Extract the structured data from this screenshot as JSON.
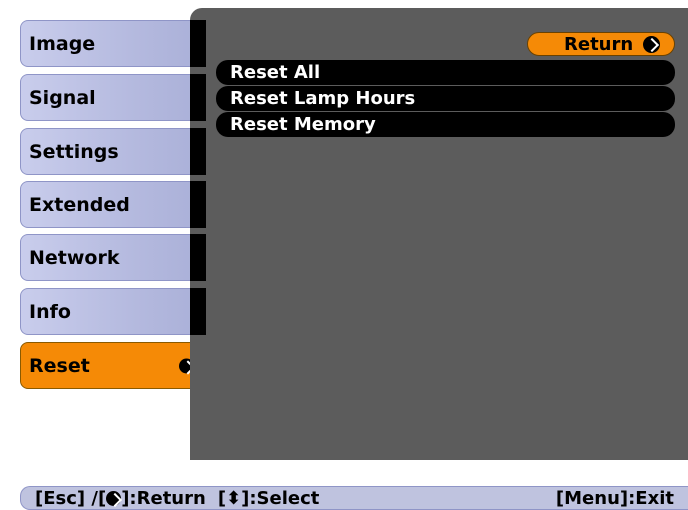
{
  "sidebar": {
    "items": [
      {
        "label": "Image"
      },
      {
        "label": "Signal"
      },
      {
        "label": "Settings"
      },
      {
        "label": "Extended"
      },
      {
        "label": "Network"
      },
      {
        "label": "Info"
      },
      {
        "label": "Reset",
        "active": true
      }
    ]
  },
  "panel": {
    "return_label": "Return",
    "items": [
      {
        "label": "Reset All"
      },
      {
        "label": "Reset Lamp Hours"
      },
      {
        "label": "Reset Memory"
      }
    ]
  },
  "footer": {
    "esc_label": "[Esc] /[",
    "return_label": "]:Return",
    "select_label": "[⬍]:Select",
    "exit_label": "[Menu]:Exit"
  },
  "colors": {
    "accent": "#f58a06",
    "panel": "#5c5c5c",
    "sidebar": "#b5badf"
  }
}
